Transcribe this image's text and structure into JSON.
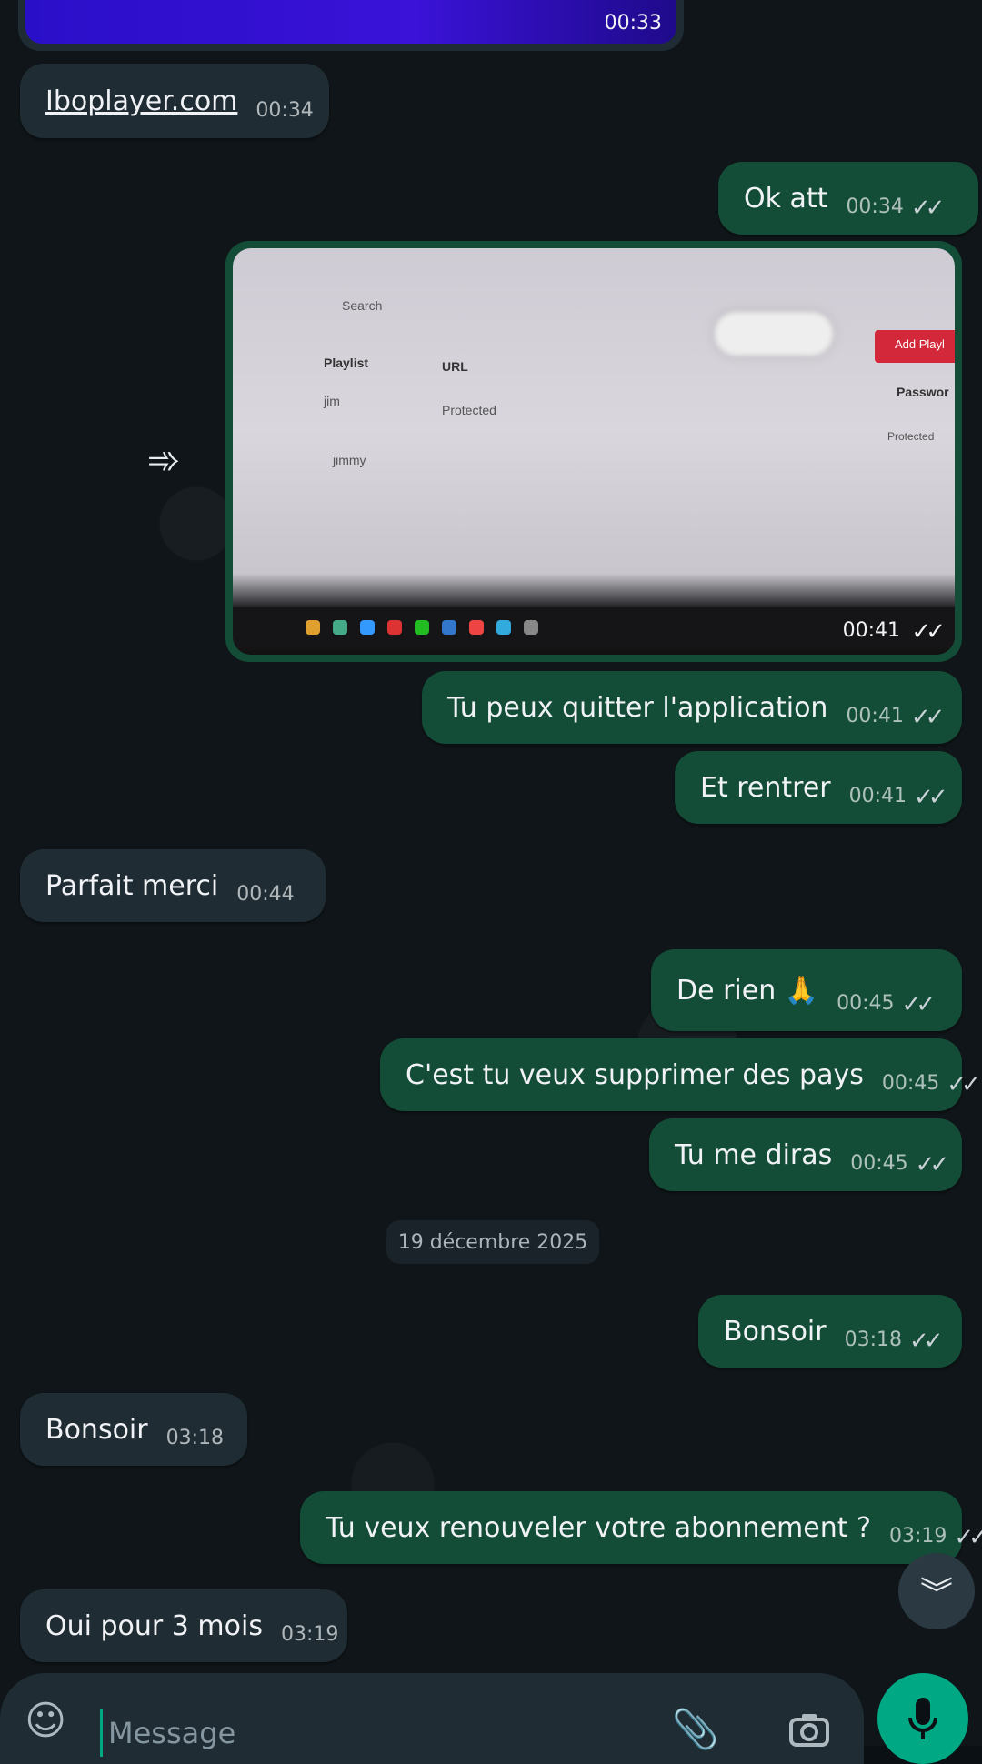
{
  "colors": {
    "outgoing_bubble": "#144d37",
    "incoming_bubble": "#1f2c33",
    "accent": "#00a884",
    "link": "#53bdeb"
  },
  "top_media": {
    "time": "00:33"
  },
  "messages": [
    {
      "dir": "in",
      "text": "Iboplayer.com",
      "time": "00:34",
      "is_link": true
    },
    {
      "dir": "out",
      "text": "Ok att",
      "time": "00:34",
      "ticks": "✓✓"
    },
    {
      "dir": "out",
      "text": "Tu peux quitter l'application",
      "time": "00:41",
      "ticks": "✓✓"
    },
    {
      "dir": "out",
      "text": "Et rentrer",
      "time": "00:41",
      "ticks": "✓✓"
    },
    {
      "dir": "in",
      "text": "Parfait merci",
      "time": "00:44"
    },
    {
      "dir": "out",
      "text": "De rien 🙏",
      "time": "00:45",
      "ticks": "✓✓"
    },
    {
      "dir": "out",
      "text": "C'est tu veux supprimer des pays",
      "time": "00:45",
      "ticks": "✓✓"
    },
    {
      "dir": "out",
      "text": "Tu me diras",
      "time": "00:45",
      "ticks": "✓✓"
    },
    {
      "dir": "out",
      "text": "Bonsoir",
      "time": "03:18",
      "ticks": "✓✓"
    },
    {
      "dir": "in",
      "text": "Bonsoir",
      "time": "03:18"
    },
    {
      "dir": "out",
      "text": "Tu veux renouveler votre abonnement ?",
      "time": "03:19",
      "ticks": "✓✓"
    },
    {
      "dir": "in",
      "text": "Oui pour 3 mois",
      "time": "03:19"
    }
  ],
  "media_message": {
    "time": "00:41",
    "ticks": "✓✓",
    "screenshot_labels": {
      "search": "Search",
      "col_playlist": "Playlist",
      "col_url": "URL",
      "col_password": "Passwor",
      "row1_name": "jim",
      "row1_url": "Protected",
      "row1_pw": "Protected",
      "row2_name": "jimmy",
      "add_button": "Add Playl"
    }
  },
  "date_separator": "19 décembre 2025",
  "input": {
    "placeholder": "Message"
  },
  "icons": {
    "forward": "forward-icon",
    "scroll_down": "double-chevron-down-icon",
    "emoji": "sticker-icon",
    "attach": "paperclip-icon",
    "camera": "camera-icon",
    "mic": "mic-icon"
  }
}
